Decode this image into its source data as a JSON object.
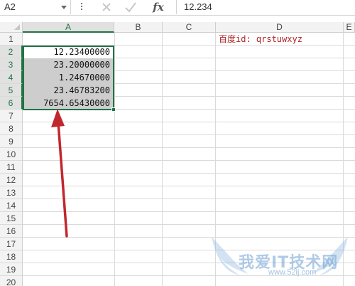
{
  "formula_bar": {
    "name_box": "A2",
    "formula_value": "12.234",
    "icons": [
      "cancel-icon",
      "confirm-icon",
      "fx-icon"
    ],
    "fx_label": "fx"
  },
  "grid": {
    "columns": [
      "A",
      "B",
      "C",
      "D",
      "E"
    ],
    "rows": [
      "1",
      "2",
      "3",
      "4",
      "5",
      "6",
      "7",
      "8",
      "9",
      "10",
      "11",
      "12",
      "13",
      "14",
      "15",
      "16",
      "17",
      "18",
      "19",
      "20"
    ],
    "selected_range": "A2:A6",
    "active_cell": "A2",
    "cells": {
      "A2": "12.23400000",
      "A3": "23.20000000",
      "A4": "1.24670000",
      "A5": "23.46783200",
      "A6": "7654.65430000",
      "D1": "百度id: qrstuwxyz"
    }
  },
  "annotation": {
    "arrow_color": "#c0282d",
    "arrow_target": "A6"
  },
  "watermark": {
    "text": "我爱IT技术网",
    "url": "www.52ij.com"
  },
  "colors": {
    "accent": "#217346",
    "selection_fill": "#cdcdcd",
    "note_text": "#b22222"
  }
}
